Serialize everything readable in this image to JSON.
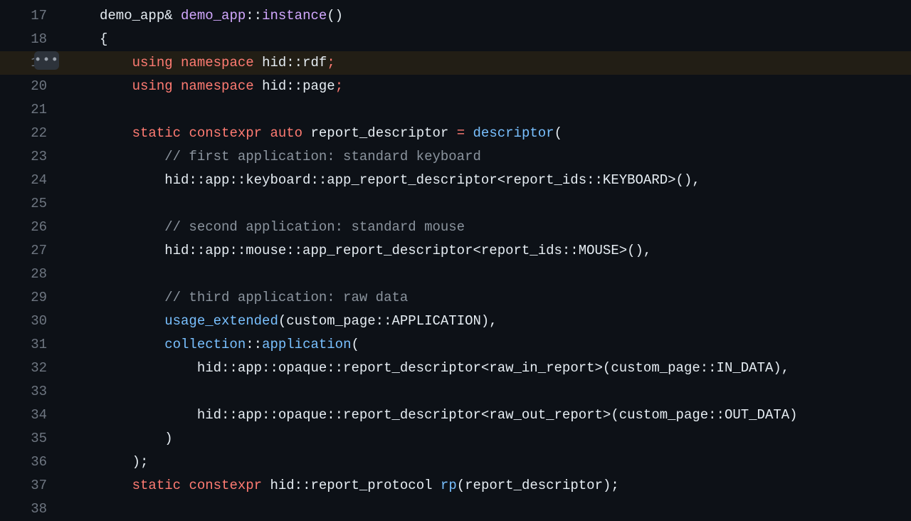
{
  "ellipsis": "•••",
  "highlight_index": 2,
  "lines": [
    {
      "num": "17",
      "tokens": [
        {
          "t": "demo_app",
          "c": "id"
        },
        {
          "t": "& ",
          "c": "punc"
        },
        {
          "t": "demo_app",
          "c": "fn"
        },
        {
          "t": "::",
          "c": "punc"
        },
        {
          "t": "instance",
          "c": "fn"
        },
        {
          "t": "()",
          "c": "punc"
        }
      ]
    },
    {
      "num": "18",
      "tokens": [
        {
          "t": "{",
          "c": "punc"
        }
      ]
    },
    {
      "num": "19",
      "tokens": [
        {
          "t": "    ",
          "c": "punc"
        },
        {
          "t": "using",
          "c": "kw"
        },
        {
          "t": " ",
          "c": "punc"
        },
        {
          "t": "namespace",
          "c": "kw"
        },
        {
          "t": " ",
          "c": "punc"
        },
        {
          "t": "hid",
          "c": "id"
        },
        {
          "t": "::",
          "c": "punc"
        },
        {
          "t": "rdf",
          "c": "id"
        },
        {
          "t": ";",
          "c": "kw"
        }
      ]
    },
    {
      "num": "20",
      "tokens": [
        {
          "t": "    ",
          "c": "punc"
        },
        {
          "t": "using",
          "c": "kw"
        },
        {
          "t": " ",
          "c": "punc"
        },
        {
          "t": "namespace",
          "c": "kw"
        },
        {
          "t": " ",
          "c": "punc"
        },
        {
          "t": "hid",
          "c": "id"
        },
        {
          "t": "::",
          "c": "punc"
        },
        {
          "t": "page",
          "c": "id"
        },
        {
          "t": ";",
          "c": "kw"
        }
      ]
    },
    {
      "num": "21",
      "tokens": [
        {
          "t": "",
          "c": "punc"
        }
      ]
    },
    {
      "num": "22",
      "tokens": [
        {
          "t": "    ",
          "c": "punc"
        },
        {
          "t": "static",
          "c": "kw"
        },
        {
          "t": " ",
          "c": "punc"
        },
        {
          "t": "constexpr",
          "c": "kw"
        },
        {
          "t": " ",
          "c": "punc"
        },
        {
          "t": "auto",
          "c": "kw"
        },
        {
          "t": " ",
          "c": "punc"
        },
        {
          "t": "report_descriptor ",
          "c": "id"
        },
        {
          "t": "=",
          "c": "kw"
        },
        {
          "t": " ",
          "c": "punc"
        },
        {
          "t": "descriptor",
          "c": "cal"
        },
        {
          "t": "(",
          "c": "punc"
        }
      ]
    },
    {
      "num": "23",
      "tokens": [
        {
          "t": "        ",
          "c": "punc"
        },
        {
          "t": "// first application: standard keyboard",
          "c": "cm"
        }
      ]
    },
    {
      "num": "24",
      "tokens": [
        {
          "t": "        ",
          "c": "punc"
        },
        {
          "t": "hid::app::keyboard::app_report_descriptor<report_ids::KEYBOARD>(),",
          "c": "id"
        }
      ]
    },
    {
      "num": "25",
      "tokens": [
        {
          "t": "",
          "c": "punc"
        }
      ]
    },
    {
      "num": "26",
      "tokens": [
        {
          "t": "        ",
          "c": "punc"
        },
        {
          "t": "// second application: standard mouse",
          "c": "cm"
        }
      ]
    },
    {
      "num": "27",
      "tokens": [
        {
          "t": "        ",
          "c": "punc"
        },
        {
          "t": "hid::app::mouse::app_report_descriptor<report_ids::MOUSE>(),",
          "c": "id"
        }
      ]
    },
    {
      "num": "28",
      "tokens": [
        {
          "t": "",
          "c": "punc"
        }
      ]
    },
    {
      "num": "29",
      "tokens": [
        {
          "t": "        ",
          "c": "punc"
        },
        {
          "t": "// third application: raw data",
          "c": "cm"
        }
      ]
    },
    {
      "num": "30",
      "tokens": [
        {
          "t": "        ",
          "c": "punc"
        },
        {
          "t": "usage_extended",
          "c": "cal"
        },
        {
          "t": "(custom_page::APPLICATION),",
          "c": "id"
        }
      ]
    },
    {
      "num": "31",
      "tokens": [
        {
          "t": "        ",
          "c": "punc"
        },
        {
          "t": "collection",
          "c": "cal"
        },
        {
          "t": "::",
          "c": "punc"
        },
        {
          "t": "application",
          "c": "cal"
        },
        {
          "t": "(",
          "c": "punc"
        }
      ]
    },
    {
      "num": "32",
      "tokens": [
        {
          "t": "            ",
          "c": "punc"
        },
        {
          "t": "hid::app::opaque::report_descriptor<raw_in_report>(custom_page::IN_DATA),",
          "c": "id"
        }
      ]
    },
    {
      "num": "33",
      "tokens": [
        {
          "t": "",
          "c": "punc"
        }
      ]
    },
    {
      "num": "34",
      "tokens": [
        {
          "t": "            ",
          "c": "punc"
        },
        {
          "t": "hid::app::opaque::report_descriptor<raw_out_report>(custom_page::OUT_DATA)",
          "c": "id"
        }
      ]
    },
    {
      "num": "35",
      "tokens": [
        {
          "t": "        ",
          "c": "punc"
        },
        {
          "t": ")",
          "c": "punc"
        }
      ]
    },
    {
      "num": "36",
      "tokens": [
        {
          "t": "    ",
          "c": "punc"
        },
        {
          "t": ");",
          "c": "punc"
        }
      ]
    },
    {
      "num": "37",
      "tokens": [
        {
          "t": "    ",
          "c": "punc"
        },
        {
          "t": "static",
          "c": "kw"
        },
        {
          "t": " ",
          "c": "punc"
        },
        {
          "t": "constexpr",
          "c": "kw"
        },
        {
          "t": " ",
          "c": "punc"
        },
        {
          "t": "hid::report_protocol ",
          "c": "id"
        },
        {
          "t": "rp",
          "c": "cal"
        },
        {
          "t": "(report_descriptor);",
          "c": "id"
        }
      ]
    },
    {
      "num": "38",
      "tokens": [
        {
          "t": "",
          "c": "punc"
        }
      ]
    }
  ]
}
